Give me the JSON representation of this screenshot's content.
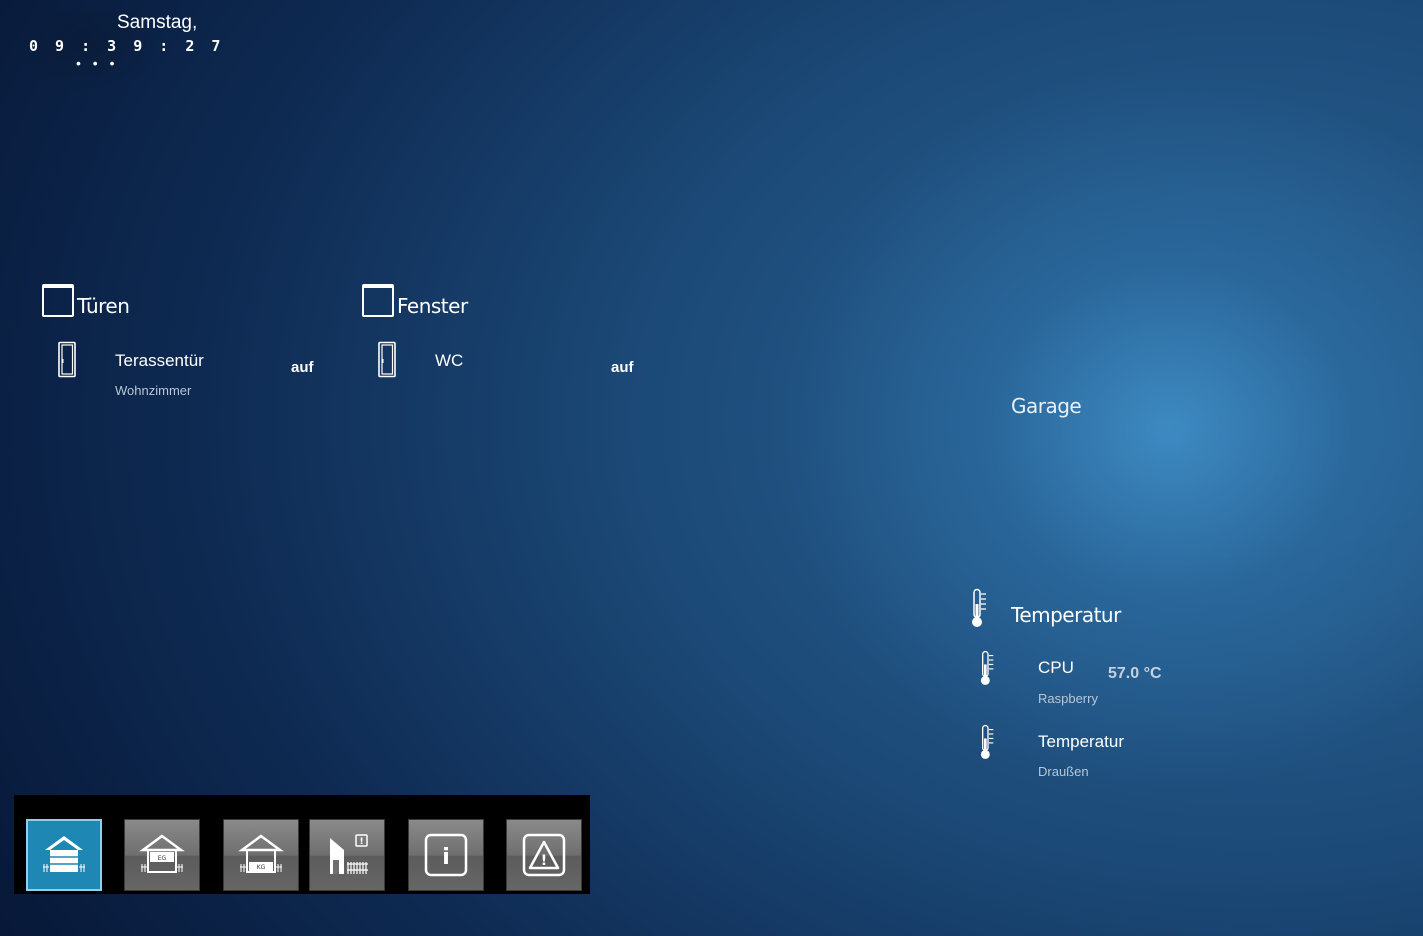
{
  "header": {
    "weekday": "Samstag,",
    "time": "0 9 : 3 9 : 2 7",
    "dots": "• • •"
  },
  "groups": {
    "tueren": {
      "title": "Türen",
      "icon": "window-frame-icon",
      "device": {
        "name": "Terassentür",
        "room": "Wohnzimmer",
        "state": "auf",
        "icon": "door-icon"
      }
    },
    "fenster": {
      "title": "Fenster",
      "icon": "window-frame-icon",
      "device": {
        "name": "WC",
        "state": "auf",
        "icon": "door-icon"
      }
    },
    "garage": {
      "title": "Garage"
    },
    "temperatur": {
      "title": "Temperatur",
      "icon": "thermometer-icon",
      "devices": [
        {
          "name": "CPU",
          "sub": "Raspberry",
          "value": "57.0 °C",
          "icon": "thermometer-icon"
        },
        {
          "name": "Temperatur",
          "sub": "Draußen",
          "value": "",
          "icon": "thermometer-icon"
        }
      ]
    }
  },
  "nav": {
    "buttons": [
      {
        "id": "home",
        "icon": "house-overview-icon",
        "label": "",
        "active": true
      },
      {
        "id": "eg",
        "icon": "house-floor-icon",
        "label": "EG",
        "active": false
      },
      {
        "id": "kg",
        "icon": "house-floor-icon",
        "label": "KG",
        "active": false
      },
      {
        "id": "outdoor",
        "icon": "garden-fence-icon",
        "label": "!",
        "active": false
      },
      {
        "id": "info",
        "icon": "info-icon",
        "label": "i",
        "active": false
      },
      {
        "id": "warning",
        "icon": "warning-icon",
        "label": "!",
        "active": false
      }
    ]
  },
  "colors": {
    "accent_active": "#1e87b4",
    "nav_background": "#000000",
    "nav_button": "#6f6f6f",
    "text_secondary": "#b8c6d6",
    "value_text": "#c3d2e2"
  }
}
